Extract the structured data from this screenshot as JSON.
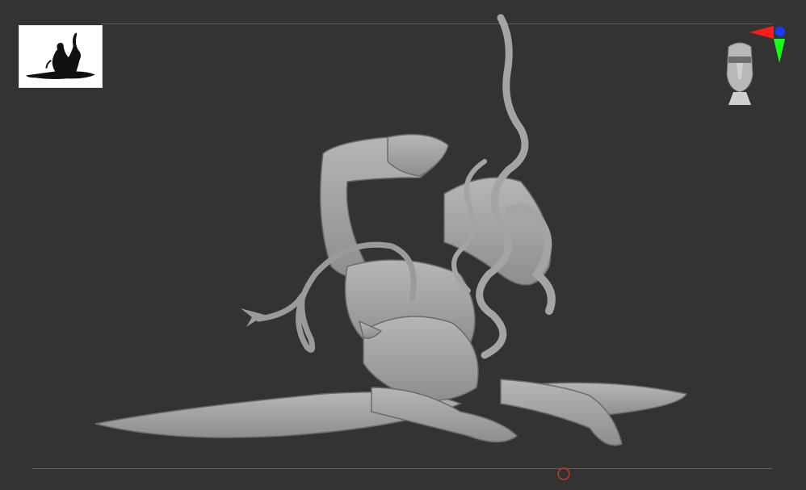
{
  "viewport": {
    "background": "#333333",
    "model_color": "#a9a9a9"
  },
  "thumbnail": {
    "icon": "silhouette-thumbnail-icon"
  },
  "navigation": {
    "icon": "head-navigation-icon"
  },
  "axis_gizmo": {
    "x_color": "#ff1a1a",
    "y_color": "#1aff1a",
    "z_color": "#1a3cff"
  },
  "cursor": {
    "icon": "brush-cursor-icon",
    "color": "#c0392b"
  }
}
